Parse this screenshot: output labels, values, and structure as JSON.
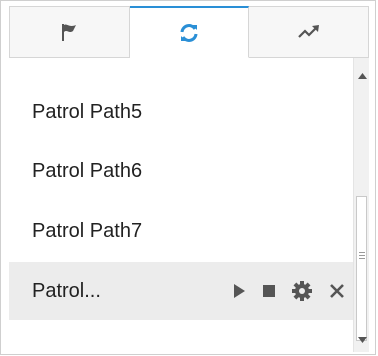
{
  "tabs": [
    {
      "icon": "flag-icon",
      "active": false
    },
    {
      "icon": "refresh-icon",
      "active": true
    },
    {
      "icon": "trend-arrow-icon",
      "active": false
    }
  ],
  "patrol_list": {
    "items": [
      {
        "label": "Patrol Path5"
      },
      {
        "label": "Patrol Path6"
      },
      {
        "label": "Patrol Path7"
      },
      {
        "label": "Patrol..."
      }
    ],
    "selected_index": 3
  },
  "colors": {
    "accent": "#2a8fd6",
    "icon": "#555555",
    "text": "#222222",
    "selected_row": "#ececec"
  }
}
